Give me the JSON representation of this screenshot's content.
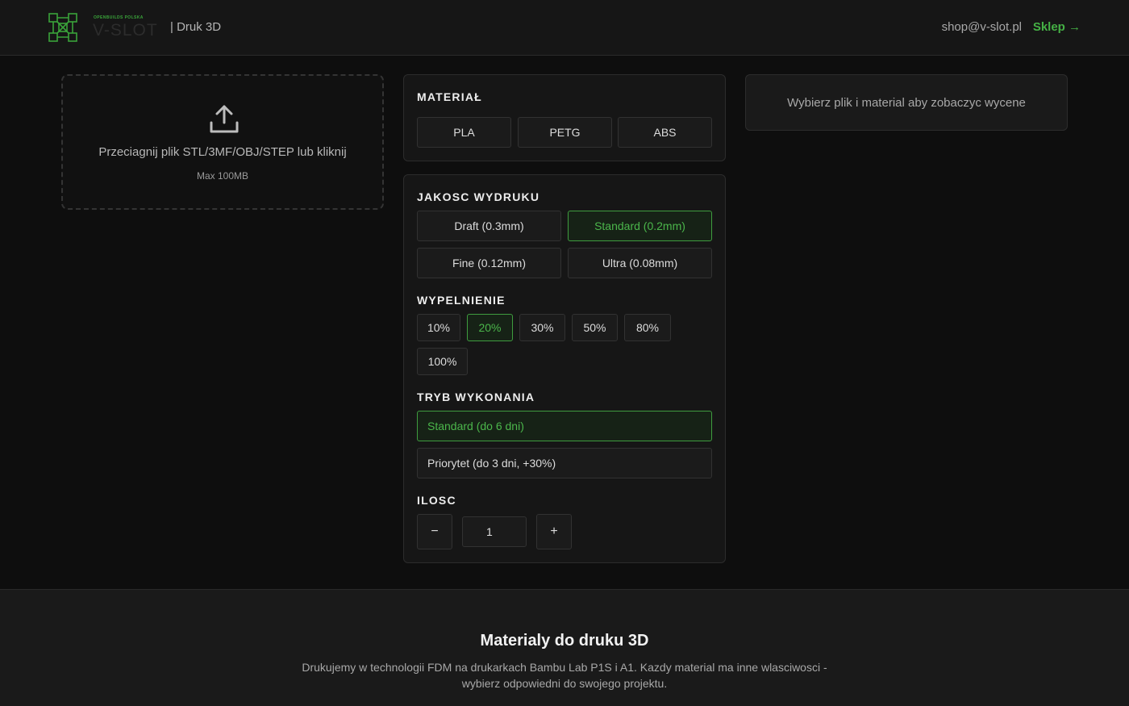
{
  "header": {
    "brand_small": "OPENBUILDS POLSKA",
    "brand_big": "V-SLOT",
    "subtitle": "| Druk 3D",
    "email": "shop@v-slot.pl",
    "shop_link": "Sklep →"
  },
  "upload": {
    "text": "Przeciagnij plik STL/3MF/OBJ/STEP lub kliknij",
    "max": "Max 100MB"
  },
  "material": {
    "label": "MATERIAŁ",
    "options": [
      "PLA",
      "PETG",
      "ABS"
    ]
  },
  "quality": {
    "label": "JAKOSC WYDRUKU",
    "options": [
      "Draft (0.3mm)",
      "Standard (0.2mm)",
      "Fine (0.12mm)",
      "Ultra (0.08mm)"
    ],
    "selected": "Standard (0.2mm)"
  },
  "infill": {
    "label": "WYPELNIENIE",
    "options": [
      "10%",
      "20%",
      "30%",
      "50%",
      "80%",
      "100%"
    ],
    "selected": "20%"
  },
  "mode": {
    "label": "TRYB WYKONANIA",
    "options": [
      "Standard (do 6 dni)",
      "Priorytet (do 3 dni, +30%)"
    ],
    "selected": "Standard (do 6 dni)"
  },
  "quantity": {
    "label": "ILOSC",
    "minus": "−",
    "value": "1",
    "plus": "+"
  },
  "summary": {
    "text": "Wybierz plik i material aby zobaczyc wycene"
  },
  "footer": {
    "title": "Materialy do druku 3D",
    "description": "Drukujemy w technologii FDM na drukarkach Bambu Lab P1S i A1. Kazdy material ma inne wlasciwosci - wybierz odpowiedni do swojego projektu."
  },
  "colors": {
    "accent": "#45b045",
    "background": "#0e0e0e",
    "panel": "#161616"
  }
}
